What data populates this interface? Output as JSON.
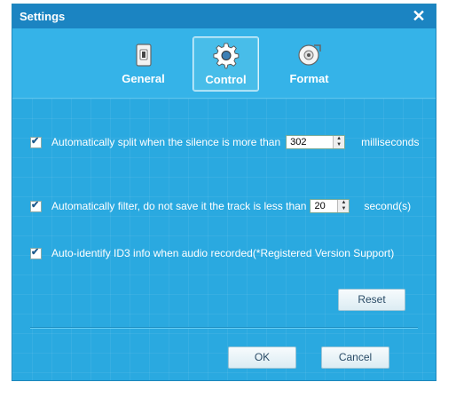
{
  "window": {
    "title": "Settings"
  },
  "tabs": [
    {
      "label": "General",
      "icon": "phone-switch-icon",
      "active": false
    },
    {
      "label": "Control",
      "icon": "gear-icon",
      "active": true
    },
    {
      "label": "Format",
      "icon": "disc-icon",
      "active": false
    }
  ],
  "options": {
    "split": {
      "checked": true,
      "label": "Automatically split when the silence is more than",
      "value": "302",
      "unit": "milliseconds"
    },
    "filter": {
      "checked": true,
      "label": "Automatically filter, do not save it the track is less than",
      "value": "20",
      "unit": "second(s)"
    },
    "id3": {
      "checked": true,
      "label": "Auto-identify ID3 info when audio recorded(*Registered Version Support)"
    }
  },
  "buttons": {
    "reset": "Reset",
    "ok": "OK",
    "cancel": "Cancel"
  },
  "colors": {
    "dialog_bg": "#29a8df",
    "titlebar_bg": "#1b84c2"
  }
}
